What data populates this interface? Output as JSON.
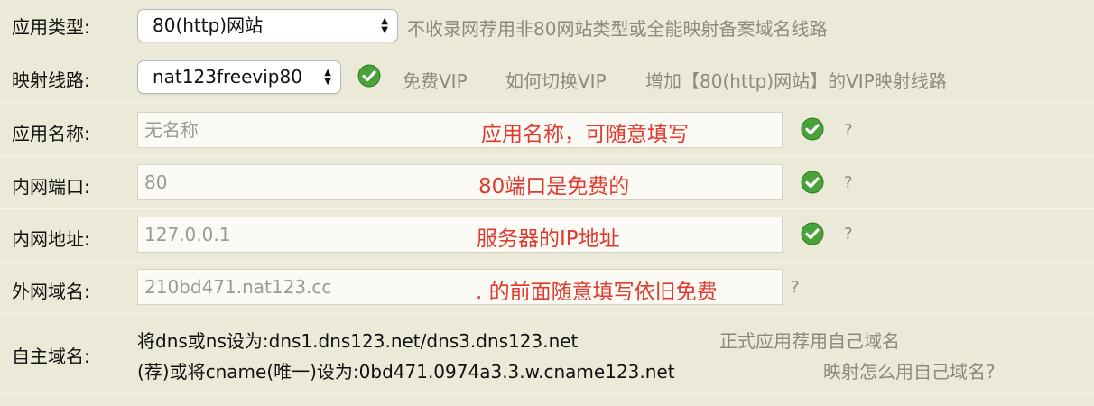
{
  "rows": {
    "app_type": {
      "label": "应用类型:",
      "selected": "80(http)网站",
      "hint": "不收录网荐用非80网站类型或全能映射备案域名线路"
    },
    "mapping_line": {
      "label": "映射线路:",
      "selected": "nat123freevip80",
      "link_free_vip": "免费VIP",
      "link_switch_vip": "如何切换VIP",
      "link_add_vip": "增加【80(http)网站】的VIP映射线路"
    },
    "app_name": {
      "label": "应用名称:",
      "placeholder": "无名称",
      "note": "应用名称，可随意填写",
      "help": "?"
    },
    "internal_port": {
      "label": "内网端口:",
      "value": "80",
      "note": "80端口是免费的",
      "help": "?"
    },
    "internal_address": {
      "label": "内网地址:",
      "value": "127.0.0.1",
      "note": "服务器的IP地址",
      "help": "?"
    },
    "external_domain": {
      "label": "外网域名:",
      "value": "210bd471.nat123.cc",
      "note": ". 的前面随意填写依旧免费",
      "help": "?"
    },
    "custom_domain": {
      "label": "自主域名:",
      "line1": "将dns或ns设为:dns1.dns123.net/dns3.dns123.net",
      "line1_hint": "正式应用荐用自己域名",
      "line2": "(荐)或将cname(唯一)设为:0bd471.0974a3.3.w.cname123.net",
      "line2_hint": "映射怎么用自己域名?"
    }
  },
  "icons": {
    "check": "check-circle-icon",
    "select_arrows": "updown-arrows-icon"
  },
  "colors": {
    "background": "#ebe9d8",
    "note_red": "#e03a2e",
    "check_green": "#4aa33a"
  }
}
